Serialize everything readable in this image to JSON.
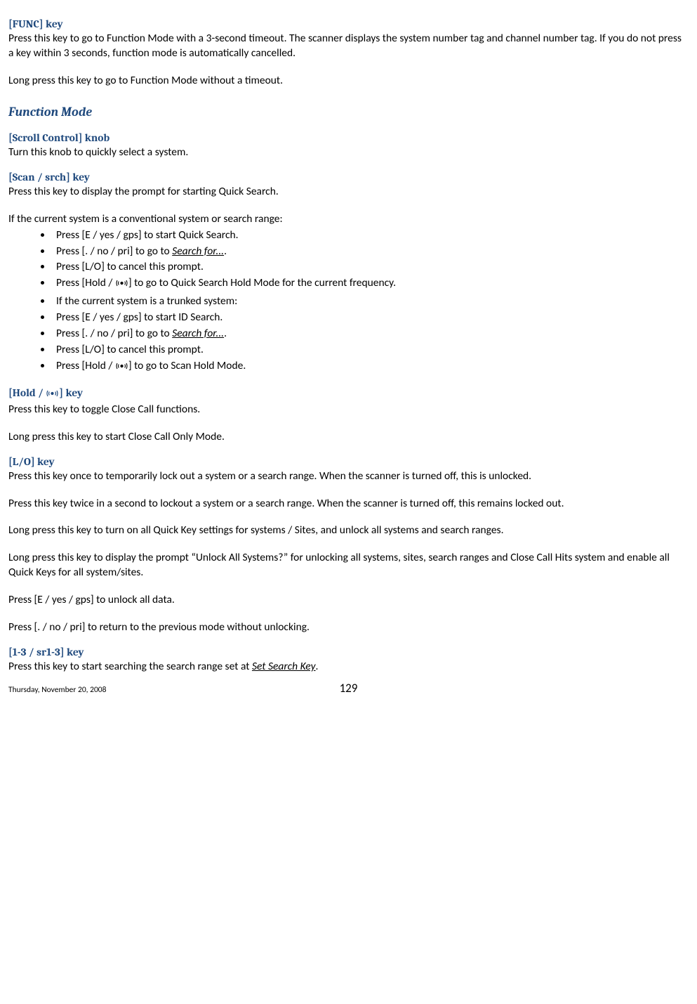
{
  "sec_func": {
    "heading": "[FUNC] key",
    "p1": "Press this key to go to Function Mode with a 3-second timeout. The scanner displays the system number tag and channel number tag. If you do not press a key within 3 seconds, function mode is automatically cancelled.",
    "p2": "Long press this key to go to Function Mode without a timeout."
  },
  "sec_mode": {
    "heading": "Function Mode"
  },
  "sec_scroll": {
    "heading": "[Scroll Control] knob",
    "p1": "Turn this knob to quickly select a system."
  },
  "sec_scan": {
    "heading": "[Scan / srch] key",
    "p1": "Press this key to display the prompt for starting Quick Search.",
    "p2": "If the current system is a conventional system or search range:",
    "li1": "Press [E / yes / gps] to start Quick Search.",
    "li2a": "Press [. / no / pri] to go to ",
    "li2b": "Search for...",
    "li2c": ".",
    "li3": "Press [L/O] to cancel this prompt.",
    "li4a": "Press [Hold / ",
    "li4b": "] to go to Quick Search Hold Mode for the current frequency.",
    "li5": "If the current system is a trunked system:",
    "li6": "Press [E / yes / gps] to start ID Search.",
    "li7a": "Press [. / no / pri] to go to ",
    "li7b": "Search for...",
    "li7c": ".",
    "li8": "Press [L/O] to cancel this prompt.",
    "li9a": "Press [Hold / ",
    "li9b": "] to go to Scan Hold Mode."
  },
  "sec_hold": {
    "heading_a": "[Hold / ",
    "heading_b": "] key",
    "p1": "Press this key to toggle Close Call functions.",
    "p2": "Long press this key to start Close Call Only Mode."
  },
  "sec_lo": {
    "heading": "[L/O] key",
    "p1": "Press this key once to temporarily lock out a system or a search range. When the scanner is turned off, this is unlocked.",
    "p2": "Press this key twice in a second to lockout a system or a search range. When the scanner is turned off, this remains locked out.",
    "p3": "Long press this key to turn on all Quick Key settings for systems / Sites, and unlock all systems and search ranges.",
    "p4": "Long press this key to display the prompt “Unlock All Systems?” for unlocking all systems, sites, search ranges and Close Call Hits system and enable all Quick Keys for all system/sites.",
    "p5": "Press [E / yes / gps] to unlock all data.",
    "p6": "Press [. / no / pri] to return to the previous mode without unlocking."
  },
  "sec_13": {
    "heading": "[1-3 / sr1-3] key",
    "p1a": "Press this key to start searching the search range set at ",
    "p1b": "Set Search Key",
    "p1c": "."
  },
  "footer": {
    "date": "Thursday, November 20, 2008",
    "page": "129"
  }
}
